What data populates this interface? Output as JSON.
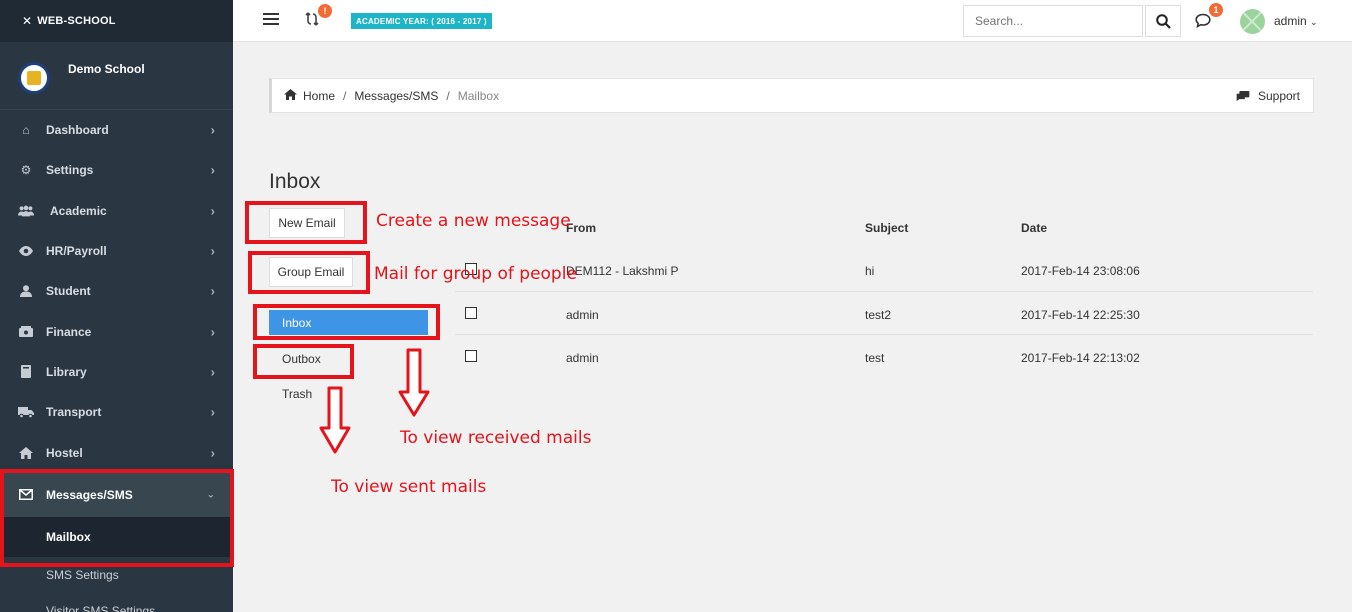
{
  "brand": "WEB-SCHOOL",
  "school_name": "Demo School",
  "nav": [
    {
      "label": "Dashboard",
      "icon": "home-icon"
    },
    {
      "label": "Settings",
      "icon": "gears-icon"
    },
    {
      "label": "Academic",
      "icon": "users-icon"
    },
    {
      "label": "HR/Payroll",
      "icon": "eye-icon"
    },
    {
      "label": "Student",
      "icon": "user-icon"
    },
    {
      "label": "Finance",
      "icon": "bank-icon"
    },
    {
      "label": "Library",
      "icon": "book-icon"
    },
    {
      "label": "Transport",
      "icon": "truck-icon"
    },
    {
      "label": "Hostel",
      "icon": "home-icon"
    },
    {
      "label": "Messages/SMS",
      "icon": "envelope-icon"
    }
  ],
  "subnav": [
    "Mailbox",
    "SMS Settings",
    "Visitor SMS Settings"
  ],
  "topbar": {
    "sync_badge": "!",
    "academic_year": "ACADEMIC YEAR: ( 2016 - 2017 )",
    "search_placeholder": "Search...",
    "chat_badge": "1",
    "user": "admin"
  },
  "breadcrumb": {
    "home": "Home",
    "section": "Messages/SMS",
    "page": "Mailbox",
    "support": "Support"
  },
  "mailbox": {
    "title": "Inbox",
    "new_email": "New Email",
    "group_email": "Group Email",
    "folders": [
      "Inbox",
      "Outbox",
      "Trash"
    ],
    "columns": {
      "from": "From",
      "subject": "Subject",
      "date": "Date"
    },
    "rows": [
      {
        "from": "DEM112 - Lakshmi P",
        "subject": "hi",
        "date": "2017-Feb-14 23:08:06"
      },
      {
        "from": "admin",
        "subject": "test2",
        "date": "2017-Feb-14 22:25:30"
      },
      {
        "from": "admin",
        "subject": "test",
        "date": "2017-Feb-14 22:13:02"
      }
    ]
  },
  "annotations": {
    "new_message": "Create a new message",
    "group_mail": "Mail for group of people",
    "received": "To view received mails",
    "sent": "To view sent mails",
    "color": "#e3141b"
  }
}
